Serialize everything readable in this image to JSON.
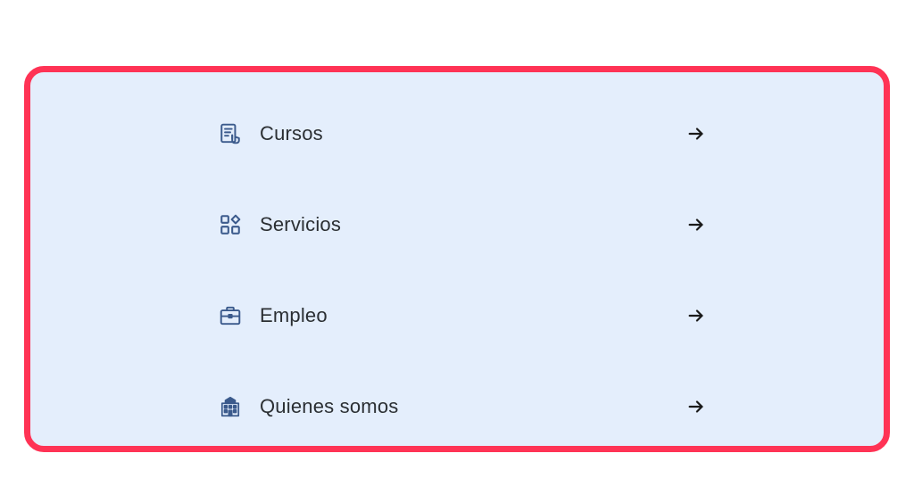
{
  "menu": {
    "items": [
      {
        "label": "Cursos",
        "icon": "course-certificate-icon",
        "arrow_icon": "arrow-right-icon"
      },
      {
        "label": "Servicios",
        "icon": "grid-services-icon",
        "arrow_icon": "arrow-right-icon"
      },
      {
        "label": "Empleo",
        "icon": "briefcase-icon",
        "arrow_icon": "arrow-right-icon"
      },
      {
        "label": "Quienes somos",
        "icon": "building-icon",
        "arrow_icon": "arrow-right-icon"
      }
    ]
  },
  "colors": {
    "card_background": "#e4eefc",
    "card_border": "#ff3355",
    "icon": "#3b5a8c",
    "text": "#2b2f33",
    "arrow": "#1a1a1a"
  }
}
